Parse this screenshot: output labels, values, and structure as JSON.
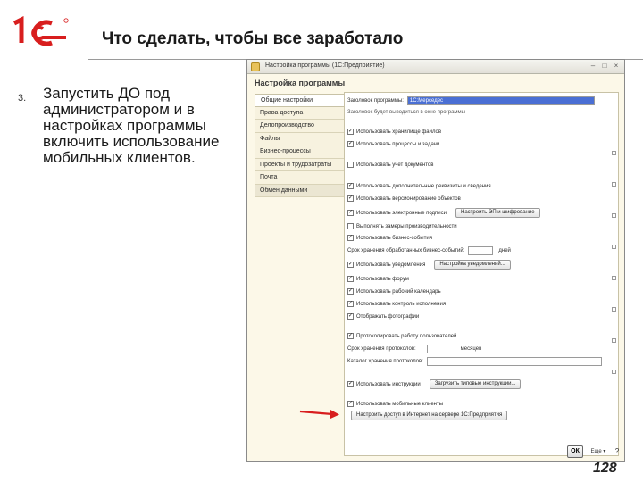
{
  "slide": {
    "title": "Что сделать, чтобы все заработало",
    "bullet_number": "3.",
    "bullet_text": "Запустить ДО под администратором и в настройках программы включить использование мобильных клиентов.",
    "page_number": "128"
  },
  "window": {
    "title": "Настройка программы (1С:Предприятие)",
    "form_title": "Настройка программы",
    "ok_label": "ОК",
    "more_label": "Еще ▾",
    "help_label": "?"
  },
  "tabs": [
    "Общие настройки",
    "Права доступа",
    "Делопроизводство",
    "Файлы",
    "Бизнес-процессы",
    "Проекты и трудозатраты",
    "Почта",
    "Обмен данными"
  ],
  "settings": {
    "header_label": "Заголовок программы:",
    "header_value": "1С:Мерседес",
    "header_hint": "Заголовок будет выводиться в окне программы",
    "use_file_storage": "Использовать хранилище файлов",
    "use_processes": "Использовать процессы и задачи",
    "use_doc_accounting": "Использовать учет документов",
    "use_extra_attrs": "Использовать дополнительные реквизиты и сведения",
    "use_object_versioning": "Использовать версионирование объектов",
    "use_digital_signature": "Использовать электронные подписи",
    "digital_signature_button": "Настроить ЭП и шифрование",
    "use_performance": "Выполнять замеры производительности",
    "use_business_events": "Использовать бизнес-события",
    "retention_label": "Срок хранения обработанных бизнес-событий:",
    "retention_unit": "дней",
    "use_notifications": "Использовать уведомления",
    "notifications_button": "Настройка уведомлений...",
    "use_forum": "Использовать форум",
    "use_work_calendar": "Использовать рабочий календарь",
    "use_doc_control": "Использовать контроль исполнения",
    "show_photos": "Отображать фотографии",
    "log_operations": "Протоколировать работу пользователей",
    "log_retention_label": "Срок хранения протоколов:",
    "log_retention_unit": "месяцев",
    "log_directory_label": "Каталог хранения протоколов:",
    "use_instructions": "Использовать инструкции",
    "instructions_button": "Загрузить типовые инструкции...",
    "use_mobile_clients": "Использовать мобильные клиенты",
    "internet_access_button": "Настроить доступ в Интернет на сервере 1С:Предприятия"
  }
}
